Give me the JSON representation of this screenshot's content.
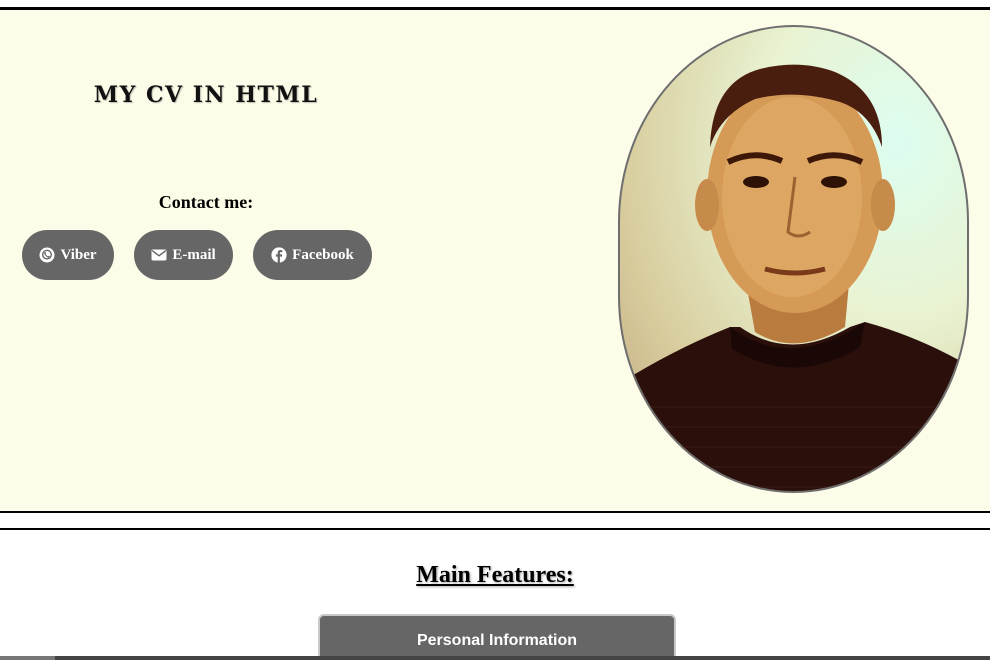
{
  "header": {
    "title": "MY CV IN HTML",
    "contact_heading": "Contact me:",
    "buttons": [
      {
        "label": "Viber",
        "icon": "viber-icon"
      },
      {
        "label": "E-mail",
        "icon": "envelope-icon"
      },
      {
        "label": "Facebook",
        "icon": "facebook-icon"
      }
    ],
    "background_color": "#fdfce9",
    "button_color": "#666666"
  },
  "main": {
    "features_title": "Main Features:",
    "tabs": [
      {
        "label": "Personal Information"
      }
    ]
  }
}
